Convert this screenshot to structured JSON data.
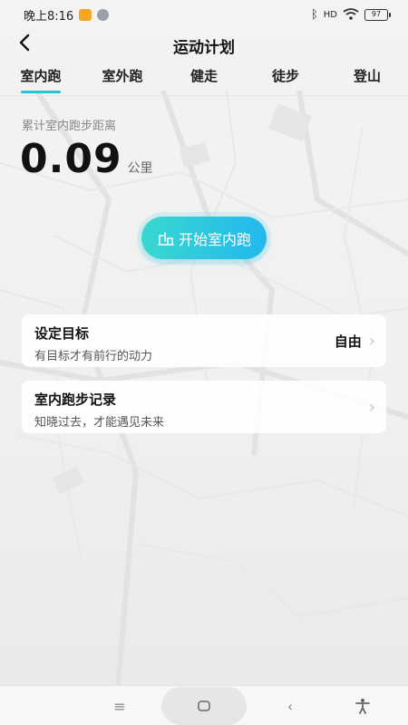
{
  "status_bar": {
    "time": "晚上8:16",
    "signal": "HD",
    "battery": "97",
    "icons": [
      "message-icon",
      "face-icon",
      "bluetooth-icon",
      "signal-icon",
      "wifi-icon",
      "battery-icon"
    ]
  },
  "header": {
    "back_icon": "back-arrow-icon",
    "title": "运动计划"
  },
  "tabs": [
    {
      "label": "室内跑",
      "active": true
    },
    {
      "label": "室外跑",
      "active": false
    },
    {
      "label": "健走",
      "active": false
    },
    {
      "label": "徒步",
      "active": false
    },
    {
      "label": "登山",
      "active": false
    }
  ],
  "distance": {
    "label": "累计室内跑步距离",
    "value": "0.09",
    "unit": "公里"
  },
  "start_button": {
    "icon": "treadmill-icon",
    "label": "开始室内跑"
  },
  "cards": {
    "goal": {
      "title": "设定目标",
      "subtitle": "有目标才有前行的动力",
      "value": "自由"
    },
    "records": {
      "title": "室内跑步记录",
      "subtitle": "知晓过去，才能遇见未来"
    }
  },
  "nav_bar": {
    "icons": [
      "menu-icon",
      "home-icon",
      "back-icon",
      "accessibility-icon"
    ]
  },
  "colors": {
    "accent": "#23c6d6",
    "button_start": "#3ad8d0",
    "button_end": "#22b8ee"
  }
}
